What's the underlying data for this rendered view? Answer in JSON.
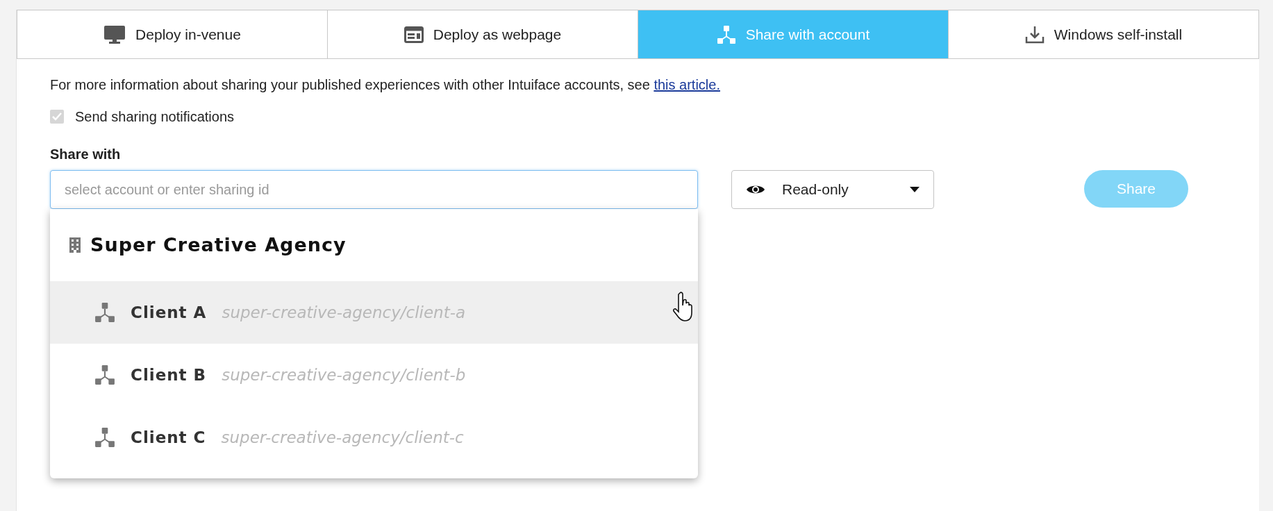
{
  "tabs": [
    {
      "label": "Deploy in-venue",
      "selected": false
    },
    {
      "label": "Deploy as webpage",
      "selected": false
    },
    {
      "label": "Share with account",
      "selected": true
    },
    {
      "label": "Windows self-install",
      "selected": false
    }
  ],
  "info": {
    "text": "For more information about sharing your published experiences with other Intuiface accounts, see",
    "link": "this article."
  },
  "notifications": {
    "label": "Send sharing notifications",
    "checked": true,
    "disabled": true
  },
  "share_with": {
    "label": "Share with",
    "placeholder": "select account or enter sharing id"
  },
  "permission": {
    "value": "Read-only"
  },
  "share_button": {
    "label": "Share",
    "disabled": true
  },
  "dropdown": {
    "group": "Super Creative Agency",
    "items": [
      {
        "name": "Client A",
        "path": "super-creative-agency/client-a",
        "highlighted": true
      },
      {
        "name": "Client B",
        "path": "super-creative-agency/client-b",
        "highlighted": false
      },
      {
        "name": "Client C",
        "path": "super-creative-agency/client-c",
        "highlighted": false
      }
    ]
  }
}
